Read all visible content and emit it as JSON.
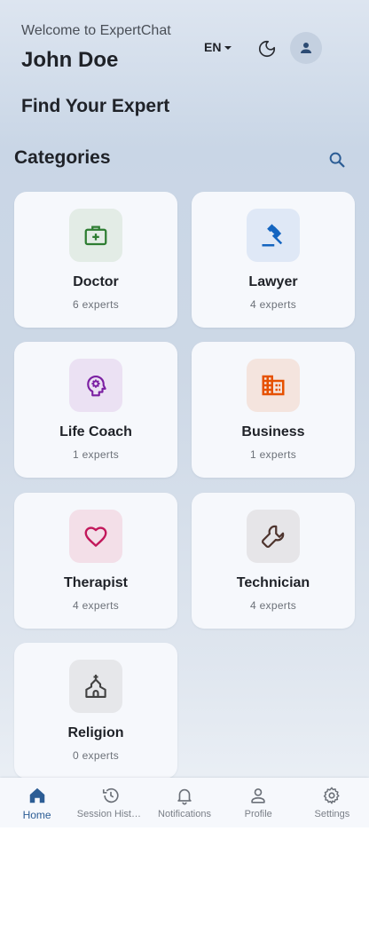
{
  "header": {
    "welcome": "Welcome to ExpertChat",
    "username": "John Doe",
    "language": "EN",
    "find_title": "Find Your Expert"
  },
  "categories_section": {
    "title": "Categories",
    "items": [
      {
        "name": "Doctor",
        "count": "6 experts",
        "icon": "medical-bag-icon",
        "icon_color": "#2e7d32",
        "bg_color": "#e3ece6"
      },
      {
        "name": "Lawyer",
        "count": "4 experts",
        "icon": "gavel-icon",
        "icon_color": "#1565c0",
        "bg_color": "#dfe8f6"
      },
      {
        "name": "Life Coach",
        "count": "1 experts",
        "icon": "psychology-icon",
        "icon_color": "#7b1fa2",
        "bg_color": "#ebe1f3"
      },
      {
        "name": "Business",
        "count": "1 experts",
        "icon": "building-icon",
        "icon_color": "#e65100",
        "bg_color": "#f4e4de"
      },
      {
        "name": "Therapist",
        "count": "4 experts",
        "icon": "heart-icon",
        "icon_color": "#c2185b",
        "bg_color": "#f3dfe8"
      },
      {
        "name": "Technician",
        "count": "4 experts",
        "icon": "wrench-icon",
        "icon_color": "#4e342e",
        "bg_color": "#e6e5e8"
      },
      {
        "name": "Religion",
        "count": "0 experts",
        "icon": "church-icon",
        "icon_color": "#424242",
        "bg_color": "#e6e7ea"
      }
    ]
  },
  "bottom_nav": {
    "items": [
      {
        "label": "Home",
        "icon": "home-icon",
        "active": true
      },
      {
        "label": "Session History",
        "icon": "history-icon",
        "active": false
      },
      {
        "label": "Notifications",
        "icon": "bell-icon",
        "active": false
      },
      {
        "label": "Profile",
        "icon": "person-icon",
        "active": false
      },
      {
        "label": "Settings",
        "icon": "gear-icon",
        "active": false
      }
    ]
  },
  "colors": {
    "accent": "#2c5d95",
    "inactive": "#7a7f87"
  }
}
